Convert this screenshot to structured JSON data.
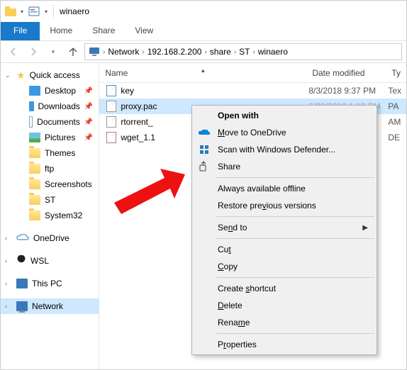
{
  "window": {
    "title": "winaero"
  },
  "ribbon": {
    "file": "File",
    "home": "Home",
    "share": "Share",
    "view": "View"
  },
  "breadcrumb": {
    "segments": [
      "Network",
      "192.168.2.200",
      "share",
      "ST",
      "winaero"
    ]
  },
  "nav": {
    "quick_access": "Quick access",
    "items": [
      {
        "label": "Desktop",
        "icon": "desktop"
      },
      {
        "label": "Downloads",
        "icon": "downloads"
      },
      {
        "label": "Documents",
        "icon": "documents"
      },
      {
        "label": "Pictures",
        "icon": "pictures"
      },
      {
        "label": "Themes",
        "icon": "folder"
      },
      {
        "label": "ftp",
        "icon": "folder"
      },
      {
        "label": "Screenshots",
        "icon": "folder"
      },
      {
        "label": "ST",
        "icon": "folder"
      },
      {
        "label": "System32",
        "icon": "folder"
      }
    ],
    "onedrive": "OneDrive",
    "wsl": "WSL",
    "thispc": "This PC",
    "network": "Network"
  },
  "columns": {
    "name": "Name",
    "date": "Date modified",
    "type": "Ty"
  },
  "files": [
    {
      "name": "key",
      "date": "8/3/2018 9:37 PM",
      "type": "Tex",
      "icon": "key"
    },
    {
      "name": "proxy.pac",
      "date": "6/29/2018 1:18 PM",
      "type": "PA",
      "icon": "pa"
    },
    {
      "name": "rtorrent_",
      "date": "",
      "type": "AM",
      "icon": "pa"
    },
    {
      "name": "wget_1.1",
      "date": "",
      "type": "DE",
      "icon": "de"
    }
  ],
  "menu": {
    "open_with": "Open with",
    "onedrive": "Move to OneDrive",
    "defender": "Scan with Windows Defender...",
    "share": "Share",
    "offline": "Always available offline",
    "restore": "Restore previous versions",
    "sendto": "Send to",
    "cut": "Cut",
    "copy": "Copy",
    "shortcut": "Create shortcut",
    "delete": "Delete",
    "rename": "Rename",
    "properties": "Properties"
  }
}
